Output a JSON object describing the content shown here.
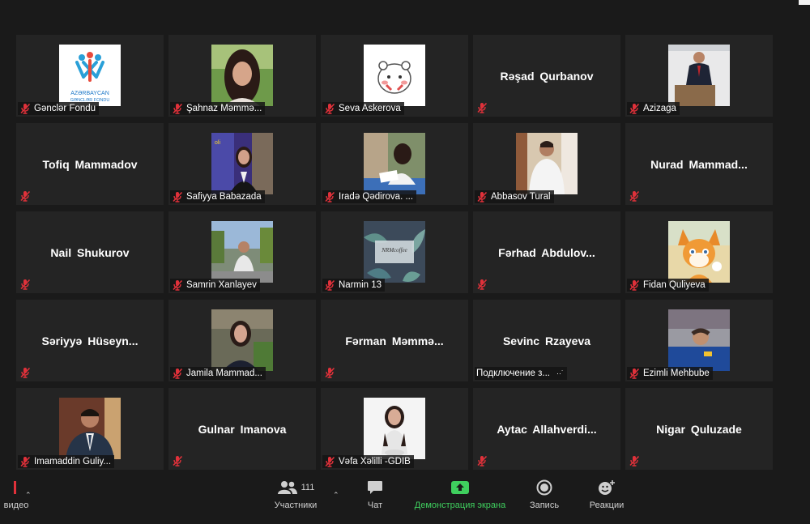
{
  "tiles": [
    {
      "name": "Gənclər Fondu",
      "label": "Gənclər Fondu",
      "thumb": "logo",
      "logo_text": [
        "AZƏRBAYCAN",
        "GƏNCLƏR FONDU"
      ]
    },
    {
      "name": "Şahnaz Məmmə...",
      "label": "Şahnaz Məmmə...",
      "thumb": "photo-woman-green"
    },
    {
      "name": "Seva Askerova",
      "label": "Seva Askerova",
      "thumb": "cartoon-bear"
    },
    {
      "name": "Rəşad Qurbanov",
      "label": "",
      "thumb": "none"
    },
    {
      "name": "Azizaga",
      "label": "Azizaga",
      "thumb": "photo-man-podium"
    },
    {
      "name": "Tofiq Mammadov",
      "label": "",
      "thumb": "none"
    },
    {
      "name": "Safiyya Babazada",
      "label": "Safiyya Babazada",
      "thumb": "photo-woman-banner"
    },
    {
      "name": "İradə Qədirova. ...",
      "label": "İradə Qədirova. ...",
      "thumb": "photo-woman-reading"
    },
    {
      "name": "Abbasov Tural",
      "label": "Abbasov Tural",
      "thumb": "photo-man-white-shirt"
    },
    {
      "name": "Nurad  Mammad...",
      "label": "",
      "thumb": "none"
    },
    {
      "name": "Nail Shukurov",
      "label": "",
      "thumb": "none"
    },
    {
      "name": "Samrin Xanlayev",
      "label": "Samrin Xanlayev",
      "thumb": "photo-man-street"
    },
    {
      "name": "Narmin 13",
      "label": "Narmin 13",
      "thumb": "leaves-logo",
      "thumb_text": "NRMcoffee"
    },
    {
      "name": "Fərhad  Abdulov...",
      "label": "",
      "thumb": "none"
    },
    {
      "name": "Fidan Quliyeva",
      "label": "Fidan Quliyeva",
      "thumb": "cartoon-fox"
    },
    {
      "name": "Səriyyə  Hüseyn...",
      "label": "",
      "thumb": "none"
    },
    {
      "name": "Jamila Mammad...",
      "label": "Jamila Mammad...",
      "thumb": "photo-woman-park"
    },
    {
      "name": "Fərman  Məmmə...",
      "label": "",
      "thumb": "none"
    },
    {
      "name": "Sevinc Rzayeva",
      "label": "Подключение з...",
      "thumb": "none",
      "connecting": true
    },
    {
      "name": "Ezimli Mehbube",
      "label": "Ezimli Mehbube",
      "thumb": "photo-child-blue"
    },
    {
      "name": "Imamaddin Guliy...",
      "label": "Imamaddin Guliy...",
      "thumb": "photo-man-suit"
    },
    {
      "name": "Gulnar Imanova",
      "label": "",
      "thumb": "none"
    },
    {
      "name": "Vəfa Xəlilli -GDIB",
      "label": "Vəfa Xəlilli -GDIB",
      "thumb": "photo-woman-white"
    },
    {
      "name": "Aytac  Allahverdi...",
      "label": "",
      "thumb": "none"
    },
    {
      "name": "Nigar Quluzade",
      "label": "",
      "thumb": "none"
    }
  ],
  "toolbar": {
    "video_label": "видео",
    "participants_label": "Участники",
    "participants_count": "111",
    "chat_label": "Чат",
    "share_label": "Демонстрация экрана",
    "record_label": "Запись",
    "reactions_label": "Реакции",
    "share_color": "#3fcf5e"
  }
}
